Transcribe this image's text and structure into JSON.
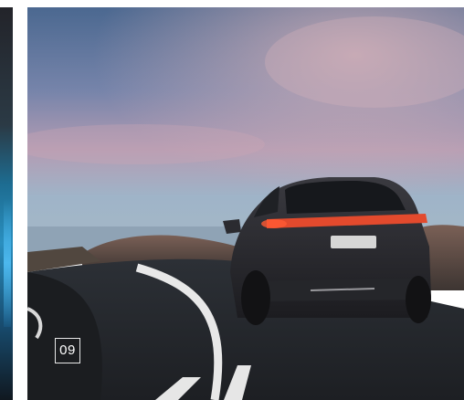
{
  "gallery": {
    "slide_number": "09",
    "image_subject": "car-driving-on-coastal-road",
    "colors": {
      "sky_top": "#4f6c93",
      "sky_mid": "#8f95b7",
      "sky_low": "#c8a4ae",
      "road": "#26292e",
      "car_body": "#2f2f33",
      "tail_light": "#e0482c",
      "badge_border": "#e8e8e8"
    }
  }
}
